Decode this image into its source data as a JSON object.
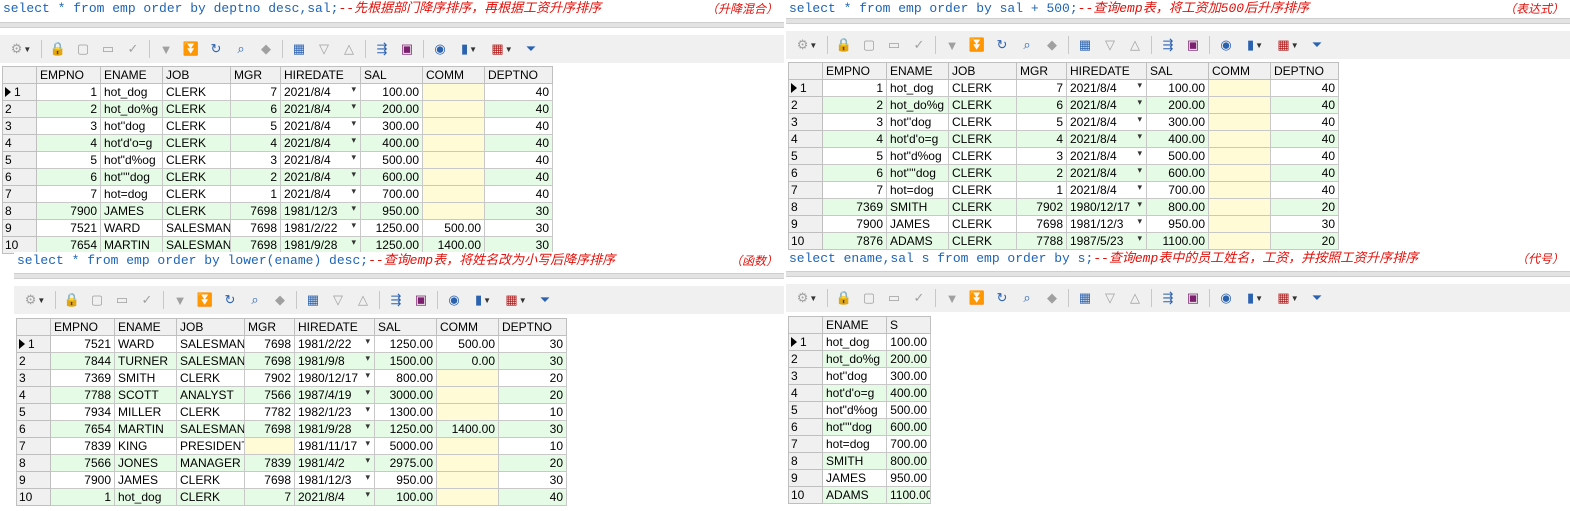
{
  "panels": [
    {
      "sql": {
        "pre": "select * from emp order by deptno desc,sal;",
        "comment": "--先根据部门降序排序，再根据工资升序排序",
        "tag": "（升降混合）"
      },
      "columns": [
        "EMPNO",
        "ENAME",
        "JOB",
        "MGR",
        "HIREDATE",
        "SAL",
        "COMM",
        "DEPTNO"
      ],
      "rows": [
        [
          "1",
          "1",
          "hot_dog",
          "CLERK",
          "7",
          "2021/8/4",
          "100.00",
          "",
          "40"
        ],
        [
          "2",
          "2",
          "hot_do%g",
          "CLERK",
          "6",
          "2021/8/4",
          "200.00",
          "",
          "40"
        ],
        [
          "3",
          "3",
          "hot''dog",
          "CLERK",
          "5",
          "2021/8/4",
          "300.00",
          "",
          "40"
        ],
        [
          "4",
          "4",
          "hot'd'o=g",
          "CLERK",
          "4",
          "2021/8/4",
          "400.00",
          "",
          "40"
        ],
        [
          "5",
          "5",
          "hot\"d%og",
          "CLERK",
          "3",
          "2021/8/4",
          "500.00",
          "",
          "40"
        ],
        [
          "6",
          "6",
          "hot''''dog",
          "CLERK",
          "2",
          "2021/8/4",
          "600.00",
          "",
          "40"
        ],
        [
          "7",
          "7",
          "hot=dog",
          "CLERK",
          "1",
          "2021/8/4",
          "700.00",
          "",
          "40"
        ],
        [
          "8",
          "7900",
          "JAMES",
          "CLERK",
          "7698",
          "1981/12/3",
          "950.00",
          "",
          "30"
        ],
        [
          "9",
          "7521",
          "WARD",
          "SALESMAN",
          "7698",
          "1981/2/22",
          "1250.00",
          "500.00",
          "30"
        ],
        [
          "10",
          "7654",
          "MARTIN",
          "SALESMAN",
          "7698",
          "1981/9/28",
          "1250.00",
          "1400.00",
          "30"
        ]
      ]
    },
    {
      "sql": {
        "pre": "select * from emp order by sal + 500;",
        "comment": "--查询emp表，将工资加500后升序排序",
        "tag": "（表达式）"
      },
      "columns": [
        "EMPNO",
        "ENAME",
        "JOB",
        "MGR",
        "HIREDATE",
        "SAL",
        "COMM",
        "DEPTNO"
      ],
      "rows": [
        [
          "1",
          "1",
          "hot_dog",
          "CLERK",
          "7",
          "2021/8/4",
          "100.00",
          "",
          "40"
        ],
        [
          "2",
          "2",
          "hot_do%g",
          "CLERK",
          "6",
          "2021/8/4",
          "200.00",
          "",
          "40"
        ],
        [
          "3",
          "3",
          "hot''dog",
          "CLERK",
          "5",
          "2021/8/4",
          "300.00",
          "",
          "40"
        ],
        [
          "4",
          "4",
          "hot'd'o=g",
          "CLERK",
          "4",
          "2021/8/4",
          "400.00",
          "",
          "40"
        ],
        [
          "5",
          "5",
          "hot\"d%og",
          "CLERK",
          "3",
          "2021/8/4",
          "500.00",
          "",
          "40"
        ],
        [
          "6",
          "6",
          "hot''''dog",
          "CLERK",
          "2",
          "2021/8/4",
          "600.00",
          "",
          "40"
        ],
        [
          "7",
          "7",
          "hot=dog",
          "CLERK",
          "1",
          "2021/8/4",
          "700.00",
          "",
          "40"
        ],
        [
          "8",
          "7369",
          "SMITH",
          "CLERK",
          "7902",
          "1980/12/17",
          "800.00",
          "",
          "20"
        ],
        [
          "9",
          "7900",
          "JAMES",
          "CLERK",
          "7698",
          "1981/12/3",
          "950.00",
          "",
          "30"
        ],
        [
          "10",
          "7876",
          "ADAMS",
          "CLERK",
          "7788",
          "1987/5/23",
          "1100.00",
          "",
          "20"
        ]
      ]
    },
    {
      "sql": {
        "pre": "select * from emp order by lower(ename) desc;",
        "comment": "--查询emp表，将姓名改为小写后降序排序",
        "tag": "（函数）"
      },
      "columns": [
        "EMPNO",
        "ENAME",
        "JOB",
        "MGR",
        "HIREDATE",
        "SAL",
        "COMM",
        "DEPTNO"
      ],
      "rows": [
        [
          "1",
          "7521",
          "WARD",
          "SALESMAN",
          "7698",
          "1981/2/22",
          "1250.00",
          "500.00",
          "30"
        ],
        [
          "2",
          "7844",
          "TURNER",
          "SALESMAN",
          "7698",
          "1981/9/8",
          "1500.00",
          "0.00",
          "30"
        ],
        [
          "3",
          "7369",
          "SMITH",
          "CLERK",
          "7902",
          "1980/12/17",
          "800.00",
          "",
          "20"
        ],
        [
          "4",
          "7788",
          "SCOTT",
          "ANALYST",
          "7566",
          "1987/4/19",
          "3000.00",
          "",
          "20"
        ],
        [
          "5",
          "7934",
          "MILLER",
          "CLERK",
          "7782",
          "1982/1/23",
          "1300.00",
          "",
          "10"
        ],
        [
          "6",
          "7654",
          "MARTIN",
          "SALESMAN",
          "7698",
          "1981/9/28",
          "1250.00",
          "1400.00",
          "30"
        ],
        [
          "7",
          "7839",
          "KING",
          "PRESIDENT",
          "",
          "1981/11/17",
          "5000.00",
          "",
          "10"
        ],
        [
          "8",
          "7566",
          "JONES",
          "MANAGER",
          "7839",
          "1981/4/2",
          "2975.00",
          "",
          "20"
        ],
        [
          "9",
          "7900",
          "JAMES",
          "CLERK",
          "7698",
          "1981/12/3",
          "950.00",
          "",
          "30"
        ],
        [
          "10",
          "1",
          "hot_dog",
          "CLERK",
          "7",
          "2021/8/4",
          "100.00",
          "",
          "40"
        ]
      ]
    },
    {
      "sql": {
        "pre": "select ename,sal s from emp order by s;",
        "comment": "--查询emp表中的员工姓名，工资，并按照工资升序排序",
        "tag": "（代号）"
      },
      "columns": [
        "ENAME",
        "S"
      ],
      "rows": [
        [
          "1",
          "hot_dog",
          "100.00"
        ],
        [
          "2",
          "hot_do%g",
          "200.00"
        ],
        [
          "3",
          "hot''dog",
          "300.00"
        ],
        [
          "4",
          "hot'd'o=g",
          "400.00"
        ],
        [
          "5",
          "hot\"d%og",
          "500.00"
        ],
        [
          "6",
          "hot''''dog",
          "600.00"
        ],
        [
          "7",
          "hot=dog",
          "700.00"
        ],
        [
          "8",
          "SMITH",
          "800.00"
        ],
        [
          "9",
          "JAMES",
          "950.00"
        ],
        [
          "10",
          "ADAMS",
          "1100.00"
        ]
      ]
    }
  ],
  "colors": {
    "keyword": "#1e64b4",
    "comment": "#e0100a",
    "alt_row": "#e6fbe6",
    "null_cell": "#fffbd6"
  },
  "toolbar_icons": [
    "query-builder-icon",
    "lock-icon",
    "add-record-icon",
    "delete-record-icon",
    "post-changes-icon",
    "next-record-icon",
    "last-record-icon",
    "refresh-icon",
    "find-icon",
    "clear-icon",
    "single-record-view-icon",
    "previous-icon",
    "first-icon",
    "export-icon",
    "save-icon",
    "query-icon",
    "chart-icon",
    "grid-view-icon",
    "filter-icon"
  ]
}
